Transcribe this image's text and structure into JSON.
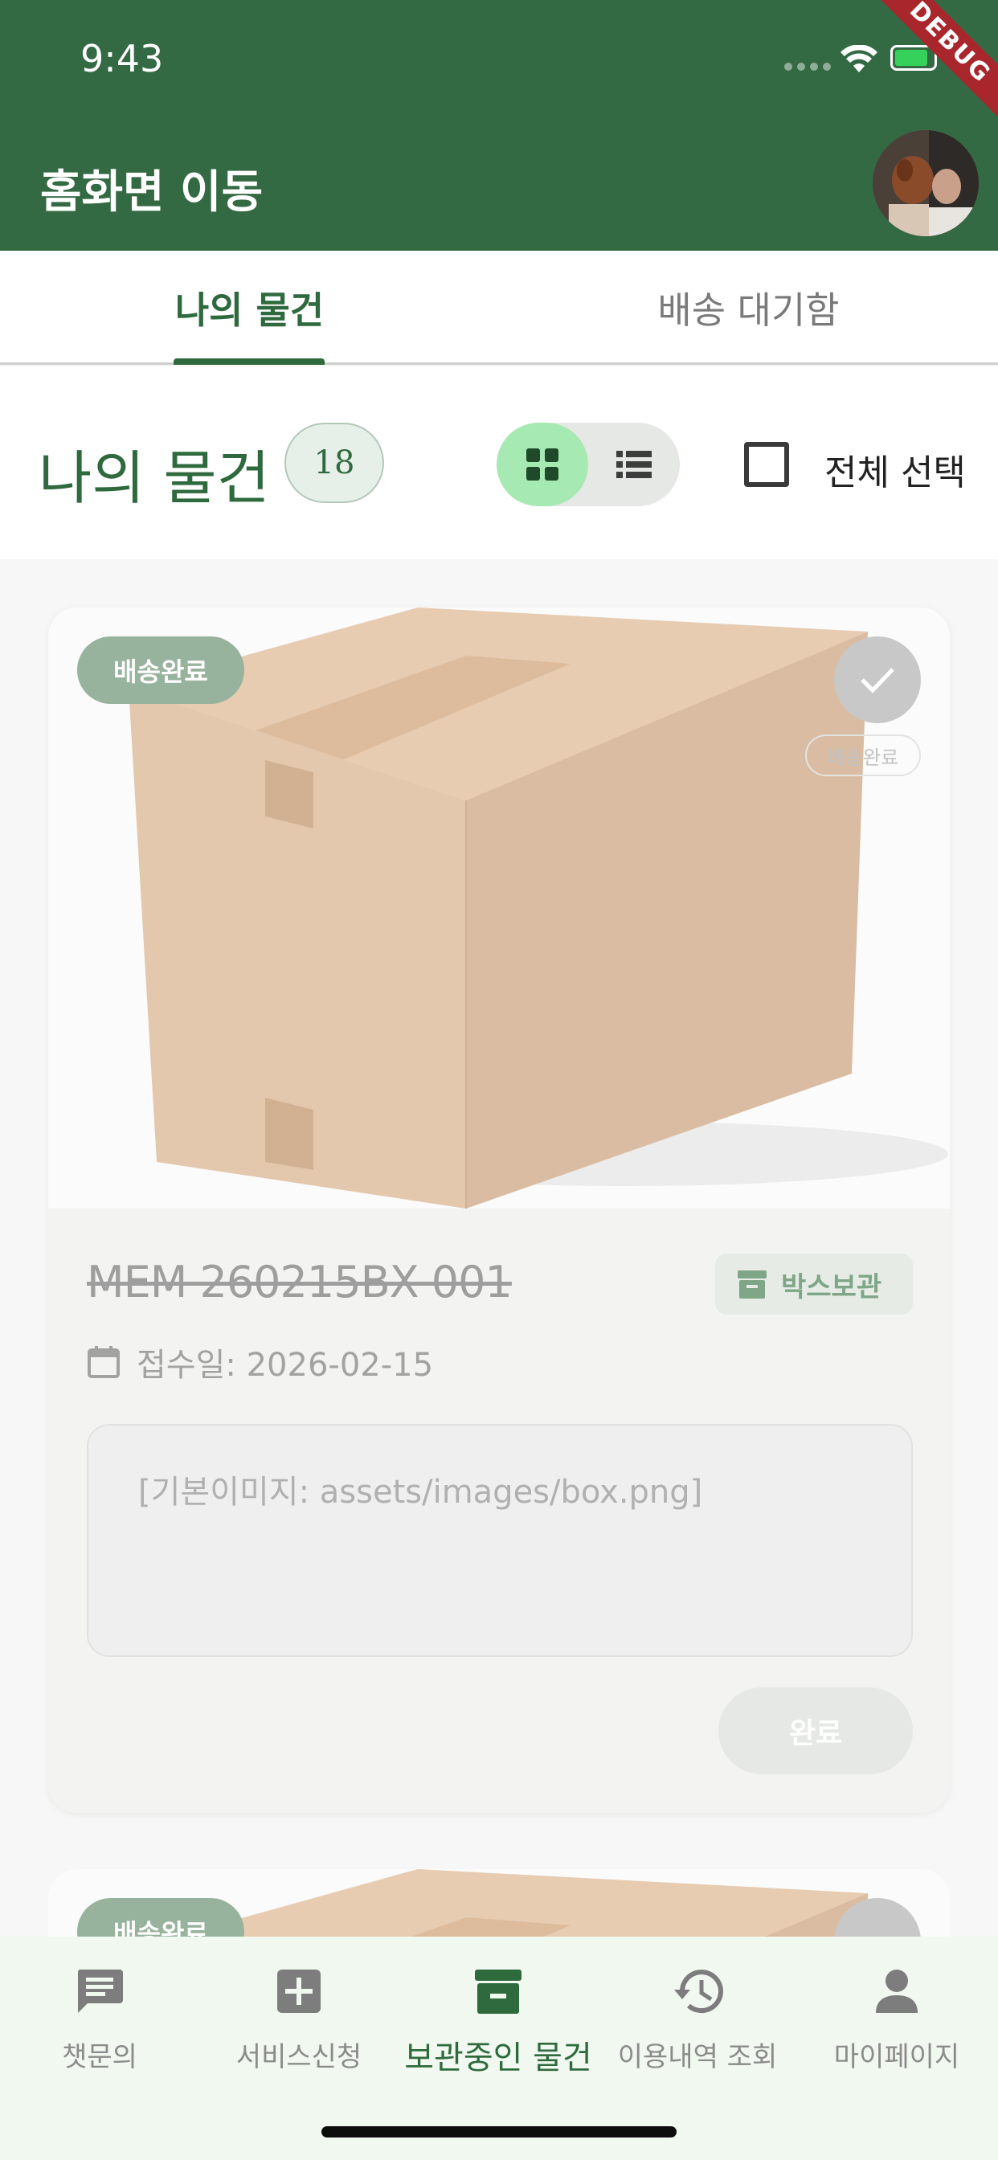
{
  "status_bar": {
    "time": "9:43",
    "debug_label": "DEBUG"
  },
  "app_bar": {
    "title": "홈화면 이동"
  },
  "tabs": [
    {
      "label": "나의 물건",
      "active": true
    },
    {
      "label": "배송 대기함",
      "active": false
    }
  ],
  "header": {
    "title": "나의 물건",
    "count": "18",
    "view_mode": "grid",
    "select_all_label": "전체 선택",
    "select_all_checked": false
  },
  "cards": [
    {
      "status": "배송완료",
      "status_small": "배송완료",
      "code": "MEM 260215BX 001",
      "storage_type": "박스보관",
      "date_text": "접수일: 2026-02-15",
      "memo": "[기본이미지: assets/images/box.png]",
      "action_label": "완료"
    },
    {
      "status": "배송완료"
    }
  ],
  "bottom_nav": [
    {
      "label": "챗문의",
      "icon": "chat-icon",
      "active": false
    },
    {
      "label": "서비스신청",
      "icon": "add-box-icon",
      "active": false
    },
    {
      "label": "보관중인 물건",
      "icon": "archive-icon",
      "active": true
    },
    {
      "label": "이용내역 조회",
      "icon": "history-icon",
      "active": false
    },
    {
      "label": "마이페이지",
      "icon": "person-icon",
      "active": false
    }
  ],
  "colors": {
    "primary": "#346a43",
    "primary_text": "#2f6a3e",
    "chip_green": "#98b39d",
    "toggle_active": "#a7e9b2",
    "nav_bg": "#f1f8ef"
  }
}
